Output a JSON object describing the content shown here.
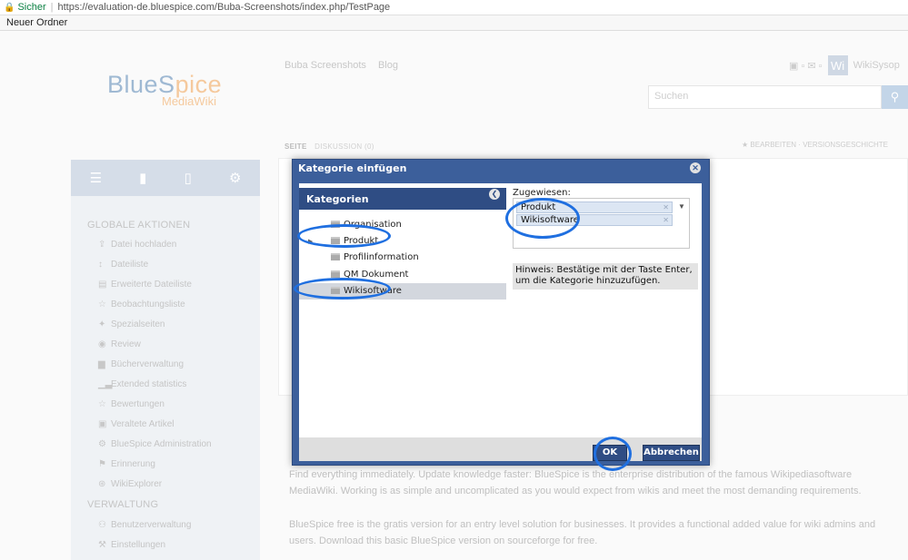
{
  "browser": {
    "secure_label": "Sicher",
    "url": "https://evaluation-de.bluespice.com/Buba-Screenshots/index.php/TestPage",
    "bookmark": "Neuer Ordner"
  },
  "site": {
    "logo_main": "BlueS",
    "logo_accent": "pice",
    "logo_sub": "MediaWiki",
    "topnav": [
      "Buba Screenshots",
      "Blog"
    ],
    "search_placeholder": "Suchen",
    "avatar": "Wi",
    "username": "WikiSysop",
    "tabs": [
      "SEITE",
      "DISKUSSION (0)"
    ],
    "page_actions": "BEARBEITEN · VERSIONSGESCHICHTE"
  },
  "sidebar": {
    "global_heading": "GLOBALE AKTIONEN",
    "global_items": [
      {
        "label": "Datei hochladen",
        "icon": "upload-icon"
      },
      {
        "label": "Dateiliste",
        "icon": "sort-icon"
      },
      {
        "label": "Erweiterte Dateiliste",
        "icon": "list-icon"
      },
      {
        "label": "Beobachtungsliste",
        "icon": "star-icon"
      },
      {
        "label": "Spezialseiten",
        "icon": "special-icon"
      },
      {
        "label": "Review",
        "icon": "eye-icon"
      },
      {
        "label": "Bücherverwaltung",
        "icon": "book-icon"
      },
      {
        "label": "Extended statistics",
        "icon": "chart-icon"
      },
      {
        "label": "Bewertungen",
        "icon": "star-icon"
      },
      {
        "label": "Veraltete Artikel",
        "icon": "expired-icon"
      },
      {
        "label": "BlueSpice Administration",
        "icon": "gear-icon"
      },
      {
        "label": "Erinnerung",
        "icon": "flag-icon"
      },
      {
        "label": "WikiExplorer",
        "icon": "explorer-icon"
      }
    ],
    "admin_heading": "VERWALTUNG",
    "admin_items": [
      {
        "label": "Benutzerverwaltung",
        "icon": "users-icon"
      },
      {
        "label": "Einstellungen",
        "icon": "wrench-icon"
      }
    ]
  },
  "content": {
    "para1": "Find everything immediately. Update knowledge faster: BlueSpice is the enterprise distribution of the famous Wikipediasoftware MediaWiki. Working is as simple and uncomplicated as you would expect from wikis and meet the most demanding requirements.",
    "para2": "BlueSpice free is the gratis version for an entry level solution for businesses. It provides a functional added value for wiki admins and users. Download this basic BlueSpice version on sourceforge for free."
  },
  "dialog": {
    "title": "Kategorie einfügen",
    "categories_header": "Kategorien",
    "tree": [
      {
        "label": "Organisation",
        "selected": false,
        "expandable": false
      },
      {
        "label": "Produkt",
        "selected": false,
        "expandable": true
      },
      {
        "label": "Profilinformation",
        "selected": false,
        "expandable": false
      },
      {
        "label": "QM Dokument",
        "selected": false,
        "expandable": false
      },
      {
        "label": "Wikisoftware",
        "selected": true,
        "expandable": false
      }
    ],
    "assigned_label": "Zugewiesen:",
    "assigned": [
      "Produkt",
      "Wikisoftware"
    ],
    "hint": "Hinweis: Bestätige mit der Taste Enter, um die Kategorie hinzuzufügen.",
    "ok_label": "OK",
    "cancel_label": "Abbrechen"
  }
}
